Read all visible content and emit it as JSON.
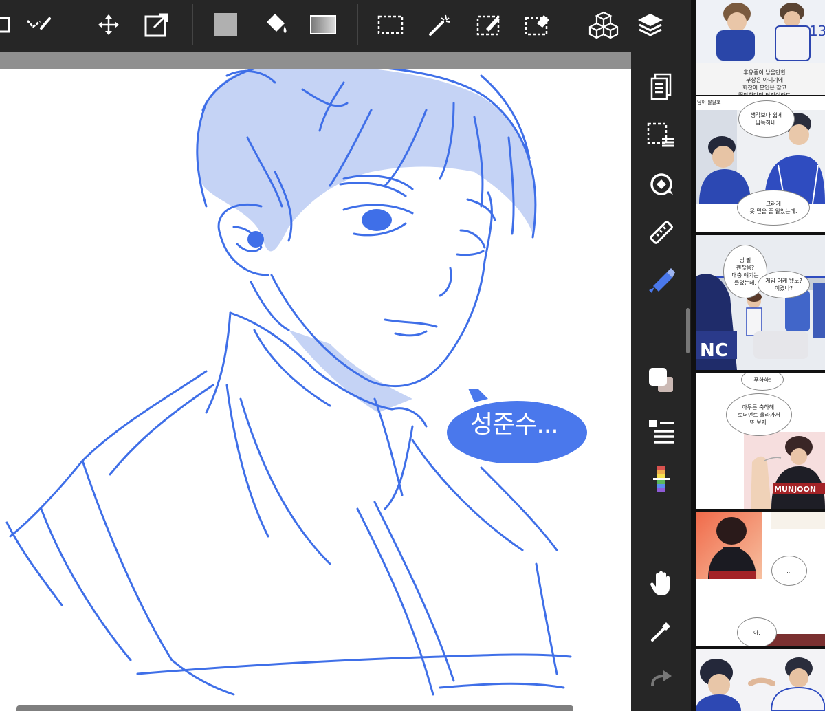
{
  "toolbar": {
    "items": [
      "layer-partial-icon",
      "transform-brush-icon",
      "move-icon",
      "scale-icon",
      "fill-color-icon",
      "paint-bucket-icon",
      "gradient-icon",
      "marquee-icon",
      "magic-wand-icon",
      "selection-pen-icon",
      "selection-eraser-icon",
      "3d-objects-icon",
      "layers-icon"
    ]
  },
  "rightbar": {
    "items": [
      "pages-icon",
      "selection-layer-icon",
      "rotate-canvas-icon",
      "ruler-icon",
      "brush-tool-icon",
      "color-swatch-icon",
      "layer-properties-icon",
      "color-wheel-icon",
      "hand-tool-icon",
      "eyedropper-icon",
      "redo-icon"
    ]
  },
  "colors": {
    "sketch": "#3f6fe8",
    "hair_fill": "#c5d3f5",
    "bubble": "#4a78ec",
    "bg": "#262626"
  },
  "canvas": {
    "speech_text": "성준수..."
  },
  "reference": {
    "panel1": {
      "caption": "후유증이 남을만한\n부상은 아니기에\n회찬이 본인은 참고\n뛸만하다며 당장이라도",
      "jersey": "13"
    },
    "panel2": {
      "corner": "남이 팔팔호",
      "bubble1": "생각보다 쉽게\n납득하네.",
      "bubble2": "그러게\n못 믿을 줄 알았는데."
    },
    "panel3": {
      "bubble1": "님 팔\n괜찮음?\n대충 얘기는\n들었는데.",
      "bubble2": "게임 어케 됐노?\n이겼나?",
      "banner": "NC"
    },
    "panel4": {
      "bubble1": "푸하하!",
      "bubble2": "아무튼 축하해.\n토너먼트 올라가서\n또 보자.",
      "jacket": "MUNJOON"
    },
    "panel5": {
      "bubble1": "...",
      "bubble2": "아."
    },
    "panel6": {}
  }
}
